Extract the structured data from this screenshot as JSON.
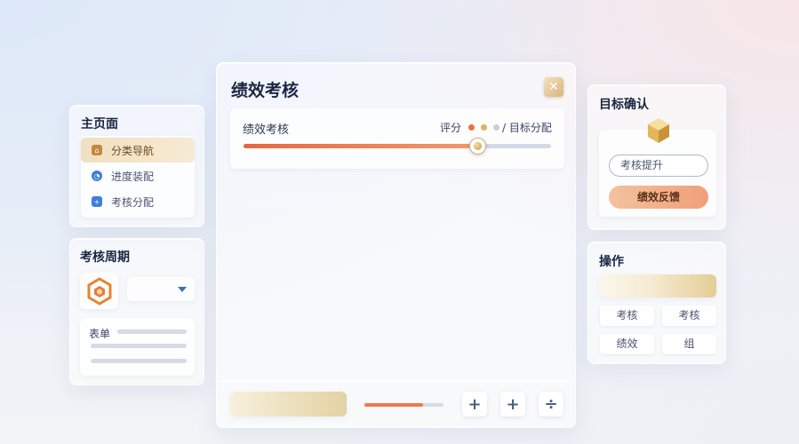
{
  "nav": {
    "title": "主页面",
    "items": [
      {
        "label": "分类导航",
        "icon": "home-icon",
        "active": true
      },
      {
        "label": "进度装配",
        "icon": "progress-icon",
        "active": false
      },
      {
        "label": "考核分配",
        "icon": "plus-circle-icon",
        "active": false
      }
    ]
  },
  "period": {
    "title": "考核周期",
    "icon": "hexagon-logo-icon",
    "select_value": "",
    "form_label": "表单"
  },
  "main": {
    "title": "绩效考核",
    "close_icon": "close-icon",
    "score_panel": {
      "label": "绩效考核",
      "score_label": "评分",
      "alloc_label": "/ 目标分配",
      "dots": [
        "#e8743e",
        "#e0b257",
        "#c9cdd6"
      ],
      "slider_value": 0.76
    },
    "footer": {
      "progress_value": 0.74,
      "buttons": [
        {
          "symbol": "+",
          "icon": "plus-icon"
        },
        {
          "symbol": "+",
          "icon": "plus-icon"
        },
        {
          "symbol": "÷",
          "icon": "divide-icon"
        }
      ]
    }
  },
  "confirm": {
    "title": "目标确认",
    "icon": "cube-icon",
    "input_value": "考核提升",
    "button_label": "绩效反馈"
  },
  "ops": {
    "title": "操作",
    "buttons": [
      "考核",
      "考核",
      "绩效",
      "组"
    ]
  },
  "colors": {
    "accent_orange": "#ee7a4e",
    "accent_gold": "#d9b46e",
    "accent_blue": "#3a6fc0"
  }
}
